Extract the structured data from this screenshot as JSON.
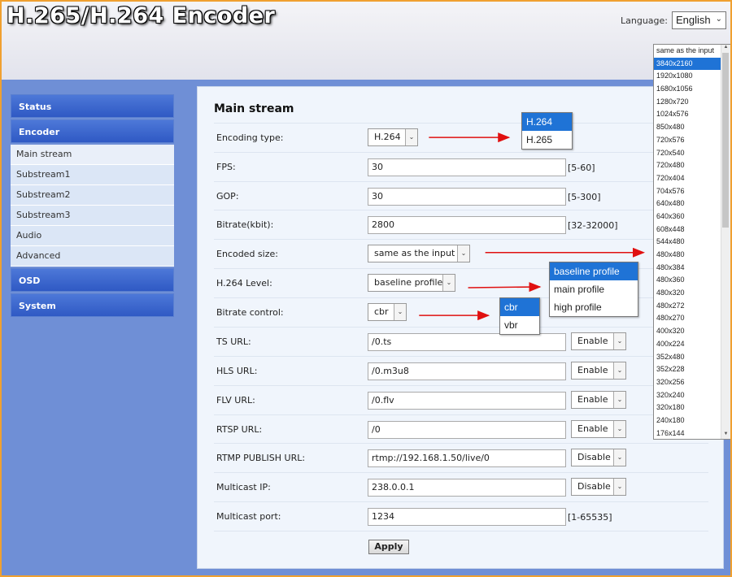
{
  "app": {
    "title": "H.265/H.264 Encoder"
  },
  "language": {
    "label": "Language:",
    "value": "English"
  },
  "sidebar": {
    "groups": [
      {
        "label": "Status"
      },
      {
        "label": "Encoder",
        "items": [
          "Main stream",
          "Substream1",
          "Substream2",
          "Substream3",
          "Audio",
          "Advanced"
        ]
      },
      {
        "label": "OSD"
      },
      {
        "label": "System"
      }
    ]
  },
  "main": {
    "title": "Main stream",
    "fields": {
      "encoding_type": {
        "label": "Encoding type:",
        "value": "H.264"
      },
      "fps": {
        "label": "FPS:",
        "value": "30",
        "hint": "[5-60]"
      },
      "gop": {
        "label": "GOP:",
        "value": "30",
        "hint": "[5-300]"
      },
      "bitrate": {
        "label": "Bitrate(kbit):",
        "value": "2800",
        "hint": "[32-32000]"
      },
      "encoded_size": {
        "label": "Encoded size:",
        "value": "same as the input"
      },
      "level": {
        "label": "H.264 Level:",
        "value": "baseline profile"
      },
      "bitrate_control": {
        "label": "Bitrate control:",
        "value": "cbr"
      },
      "ts_url": {
        "label": "TS URL:",
        "value": "/0.ts",
        "state": "Enable"
      },
      "hls_url": {
        "label": "HLS URL:",
        "value": "/0.m3u8",
        "state": "Enable"
      },
      "flv_url": {
        "label": "FLV URL:",
        "value": "/0.flv",
        "state": "Enable"
      },
      "rtsp_url": {
        "label": "RTSP URL:",
        "value": "/0",
        "state": "Enable"
      },
      "rtmp_url": {
        "label": "RTMP PUBLISH URL:",
        "value": "rtmp://192.168.1.50/live/0",
        "state": "Disable"
      },
      "multicast_ip": {
        "label": "Multicast IP:",
        "value": "238.0.0.1",
        "state": "Disable"
      },
      "multicast_port": {
        "label": "Multicast port:",
        "value": "1234",
        "hint": "[1-65535]"
      }
    },
    "apply_label": "Apply"
  },
  "popups": {
    "encoding_type": {
      "options": [
        "H.264",
        "H.265"
      ],
      "selected": 0
    },
    "level": {
      "options": [
        "baseline profile",
        "main profile",
        "high profile"
      ],
      "selected": 0
    },
    "bitrate_control": {
      "options": [
        "cbr",
        "vbr"
      ],
      "selected": 0
    },
    "encoded_size": {
      "options": [
        "same as the input",
        "3840x2160",
        "1920x1080",
        "1680x1056",
        "1280x720",
        "1024x576",
        "850x480",
        "720x576",
        "720x540",
        "720x480",
        "720x404",
        "704x576",
        "640x480",
        "640x360",
        "608x448",
        "544x480",
        "480x480",
        "480x384",
        "480x360",
        "480x320",
        "480x272",
        "480x270",
        "400x320",
        "400x224",
        "352x480",
        "352x228",
        "320x256",
        "320x240",
        "320x180",
        "240x180",
        "176x144"
      ],
      "selected": 1
    }
  },
  "colors": {
    "accent": "#1f73d6",
    "frame": "#f0a030",
    "background": "#6f8fd6",
    "annotation": "#e01010"
  }
}
